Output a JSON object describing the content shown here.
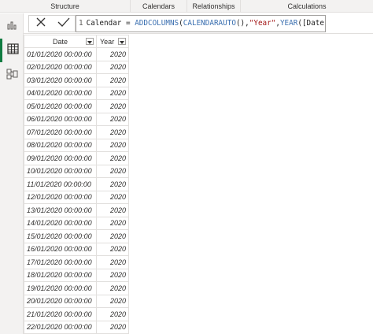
{
  "ribbon": {
    "groups": [
      "Structure",
      "Calendars",
      "Relationships",
      "Calculations"
    ]
  },
  "views": [
    "report-view",
    "data-view",
    "model-view"
  ],
  "formula": {
    "line_number": "1",
    "table_name": "Calendar",
    "equals": " = ",
    "fn1": "ADDCOLUMNS",
    "paren1": "(",
    "fn2": "CALENDARAUTO",
    "paren2": "(),",
    "str": "\"Year\"",
    "comma": ",",
    "fn3": "YEAR",
    "rest": "([Date]))"
  },
  "table": {
    "columns": [
      "Date",
      "Year"
    ],
    "rows": [
      [
        "01/01/2020 00:00:00",
        "2020"
      ],
      [
        "02/01/2020 00:00:00",
        "2020"
      ],
      [
        "03/01/2020 00:00:00",
        "2020"
      ],
      [
        "04/01/2020 00:00:00",
        "2020"
      ],
      [
        "05/01/2020 00:00:00",
        "2020"
      ],
      [
        "06/01/2020 00:00:00",
        "2020"
      ],
      [
        "07/01/2020 00:00:00",
        "2020"
      ],
      [
        "08/01/2020 00:00:00",
        "2020"
      ],
      [
        "09/01/2020 00:00:00",
        "2020"
      ],
      [
        "10/01/2020 00:00:00",
        "2020"
      ],
      [
        "11/01/2020 00:00:00",
        "2020"
      ],
      [
        "12/01/2020 00:00:00",
        "2020"
      ],
      [
        "13/01/2020 00:00:00",
        "2020"
      ],
      [
        "14/01/2020 00:00:00",
        "2020"
      ],
      [
        "15/01/2020 00:00:00",
        "2020"
      ],
      [
        "16/01/2020 00:00:00",
        "2020"
      ],
      [
        "17/01/2020 00:00:00",
        "2020"
      ],
      [
        "18/01/2020 00:00:00",
        "2020"
      ],
      [
        "19/01/2020 00:00:00",
        "2020"
      ],
      [
        "20/01/2020 00:00:00",
        "2020"
      ],
      [
        "21/01/2020 00:00:00",
        "2020"
      ],
      [
        "22/01/2020 00:00:00",
        "2020"
      ]
    ]
  },
  "colors": {
    "accent": "#107c41",
    "border": "#e1dfdd",
    "function_token": "#3a6fb0",
    "string_token": "#a31515"
  }
}
